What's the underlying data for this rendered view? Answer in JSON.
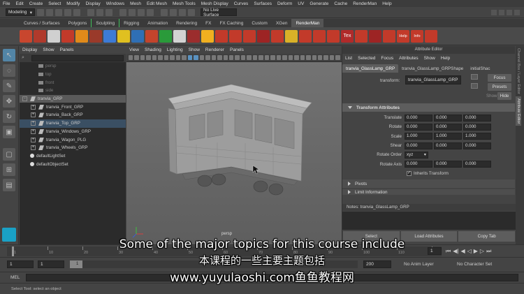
{
  "menubar": {
    "items": [
      "File",
      "Edit",
      "Create",
      "Select",
      "Modify",
      "Display",
      "Windows",
      "Mesh",
      "Edit Mesh",
      "Mesh Tools",
      "Mesh Display",
      "Curves",
      "Surfaces",
      "Deform",
      "UV",
      "Generate",
      "Cache",
      "RenderMan",
      "Help"
    ]
  },
  "statusline": {
    "mode": "Modeling",
    "live_surface": "No Live Surface"
  },
  "shelf": {
    "tabs": [
      "Curves / Surfaces",
      "Polygons",
      "Sculpting",
      "Rigging",
      "Animation",
      "Rendering",
      "FX",
      "FX Caching",
      "Custom",
      "XGen",
      "RenderMan"
    ],
    "active_tab": "RenderMan",
    "tool_colors": [
      "#c8462e",
      "#b03a2c",
      "#d0d0d0",
      "#c23a2a",
      "#e08a1a",
      "#9a3a2a",
      "#3d7bd6",
      "#e0c020",
      "#2f6fb5",
      "#c3442c",
      "#2a9a3a",
      "#d3d3d3",
      "#9b2d2d",
      "#f0b020",
      "#c23a2a",
      "#c23a2a",
      "#c23a2a",
      "#9d2424",
      "#c23a2a",
      "#d9b128",
      "#c23a2a",
      "#c23a2a",
      "#c23a2a",
      "#b02a2a",
      "#c23a2a",
      "#9d2424",
      "#c23a2a",
      "#c23a2a",
      "#c23a2a",
      "#c23a2a"
    ],
    "labels": {
      "tex": "Tex",
      "help": "Help",
      "info": "Info"
    }
  },
  "outliner": {
    "menu": [
      "Display",
      "Show",
      "Panels"
    ],
    "rows": [
      {
        "label": "persp",
        "kind": "camera",
        "state": "dim",
        "level": 1
      },
      {
        "label": "top",
        "kind": "camera",
        "state": "dim",
        "level": 1
      },
      {
        "label": "front",
        "kind": "camera",
        "state": "dim",
        "level": 1
      },
      {
        "label": "side",
        "kind": "camera",
        "state": "dim",
        "level": 1
      },
      {
        "label": "tranvia_GRP",
        "kind": "group",
        "state": "sel",
        "level": 0,
        "expander": "-"
      },
      {
        "label": "tranvia_Front_GRP",
        "kind": "group",
        "state": "",
        "level": 1,
        "expander": "+"
      },
      {
        "label": "tranvia_Back_GRP",
        "kind": "group",
        "state": "",
        "level": 1,
        "expander": "+"
      },
      {
        "label": "tranvia_Top_GRP",
        "kind": "group",
        "state": "hl",
        "level": 1,
        "expander": "+"
      },
      {
        "label": "tranvia_Windows_GRP",
        "kind": "group",
        "state": "",
        "level": 1,
        "expander": "+"
      },
      {
        "label": "tranvia_Wagon_PLG",
        "kind": "group",
        "state": "",
        "level": 1,
        "expander": "+"
      },
      {
        "label": "tranvia_Wheels_GRP",
        "kind": "group",
        "state": "",
        "level": 1,
        "expander": "+"
      },
      {
        "label": "defaultLightSet",
        "kind": "set",
        "state": "",
        "level": 0
      },
      {
        "label": "defaultObjectSet",
        "kind": "set",
        "state": "",
        "level": 0
      }
    ]
  },
  "viewport": {
    "menu": [
      "View",
      "Shading",
      "Lighting",
      "Show",
      "Renderer",
      "Panels"
    ],
    "camera_label": "persp"
  },
  "attribute_editor": {
    "title": "Attribute Editor",
    "menu": [
      "List",
      "Selected",
      "Focus",
      "Attributes",
      "Show",
      "Help"
    ],
    "tabs": [
      "tranvia_GlassLamp_GRP",
      "tranvia_GlassLamp_GRPShape",
      "initialShac"
    ],
    "transform_label": "transform:",
    "transform_value": "tranvia_GlassLamp_GRP",
    "buttons": {
      "focus": "Focus",
      "presets": "Presets",
      "show": "Show",
      "hide": "Hide"
    },
    "section_title": "Transform Attributes",
    "rows": [
      {
        "label": "Translate",
        "values": [
          "0.000",
          "0.000",
          "0.000"
        ]
      },
      {
        "label": "Rotate",
        "values": [
          "0.000",
          "0.000",
          "0.000"
        ]
      },
      {
        "label": "Scale",
        "values": [
          "1.000",
          "1.000",
          "1.000"
        ]
      },
      {
        "label": "Shear",
        "values": [
          "0.000",
          "0.000",
          "0.000"
        ]
      }
    ],
    "rotate_order_label": "Rotate Order",
    "rotate_order_value": "xyz",
    "rotate_axis_label": "Rotate Axis",
    "rotate_axis_values": [
      "0.000",
      "0.000",
      "0.000"
    ],
    "inherits_label": "Inherits Transform",
    "pivots_label": "Pivots",
    "limit_label": "Limit Information",
    "notes_label": "Notes: tranvia_GlassLamp_GRP",
    "bottom_buttons": [
      "Select",
      "Load Attributes",
      "Copy Tab"
    ]
  },
  "sidetabs": [
    "Channel Box / Layer Editor",
    "Attribute Editor"
  ],
  "timeline": {
    "ticks": [
      "1",
      "10",
      "20",
      "30",
      "40",
      "50",
      "60",
      "70",
      "80",
      "90",
      "100",
      "110",
      "120"
    ],
    "current_frame": "1"
  },
  "range": {
    "start": "1",
    "start2": "1",
    "slider_value": "1",
    "end_field": "200",
    "anim_layer": "No Anim Layer",
    "character_set": "No Character Set"
  },
  "mel": {
    "label": "MEL"
  },
  "help_line": "Select Tool: select an object",
  "subtitles": {
    "line1": "Some of the major topics for this course include",
    "line2": "本课程的一些主要主题包括",
    "line3": "www.yuyulaoshi.com鱼鱼教程网"
  }
}
